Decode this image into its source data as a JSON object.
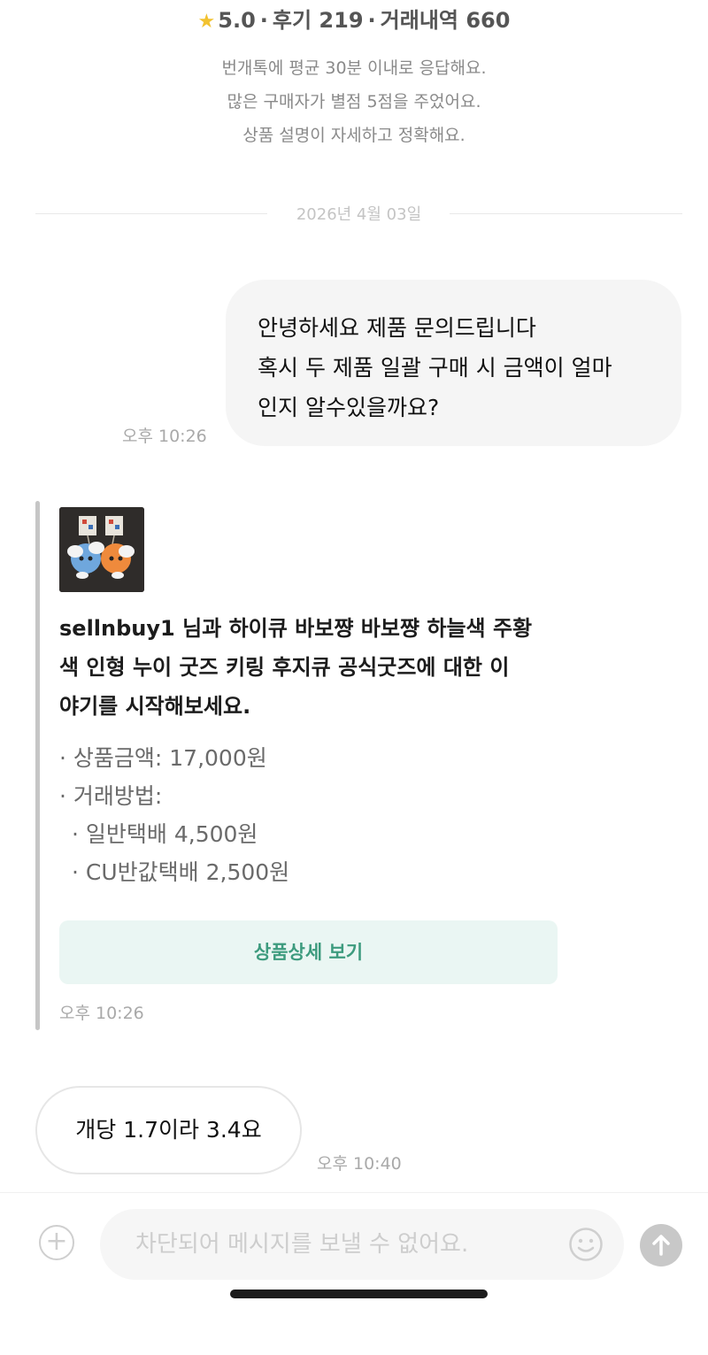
{
  "seller_stats": {
    "rating": "5.0",
    "reviews": "후기 219",
    "transactions": "거래내역 660",
    "separator": "·"
  },
  "seller_intro": [
    "번개톡에 평균 30분 이내로 응답해요.",
    "많은 구매자가 별점 5점을 주었어요.",
    "상품 설명이 자세하고 정확해요."
  ],
  "date_separator": "2026년 4월 03일",
  "messages": {
    "outgoing": {
      "lines": [
        "안녕하세요 제품 문의드립니다",
        "혹시 두 제품 일괄 구매 시 금액이 얼마",
        "인지 알수있을까요?"
      ],
      "time": "오후 10:26"
    },
    "product_card": {
      "title_lines": [
        "sellnbuy1 님과 하이큐 바보쨩 바보쨩 하늘색 주황",
        "색 인형 누이 굿즈 키링 후지큐 공식굿즈에 대한 이",
        "야기를 시작해보세요."
      ],
      "info": [
        "· 상품금액: 17,000원",
        "· 거래방법:",
        "· 일반택배 4,500원",
        "· CU반값택배 2,500원"
      ],
      "detail_button": "상품상세 보기",
      "time": "오후 10:26"
    },
    "incoming": {
      "text": "개당 1.7이라 3.4요",
      "time": "오후 10:40"
    }
  },
  "input_bar": {
    "placeholder": "차단되어 메시지를 보낼 수 없어요."
  },
  "icons": {
    "star": "star-icon",
    "add": "plus-icon",
    "emoji": "emoji-icon",
    "send": "arrow-up-icon"
  },
  "colors": {
    "star": "#f2c230",
    "accent_button_bg": "#eaf6f3",
    "accent_button_text": "#3d9b7e",
    "bubble_out_bg": "#f5f5f5"
  }
}
